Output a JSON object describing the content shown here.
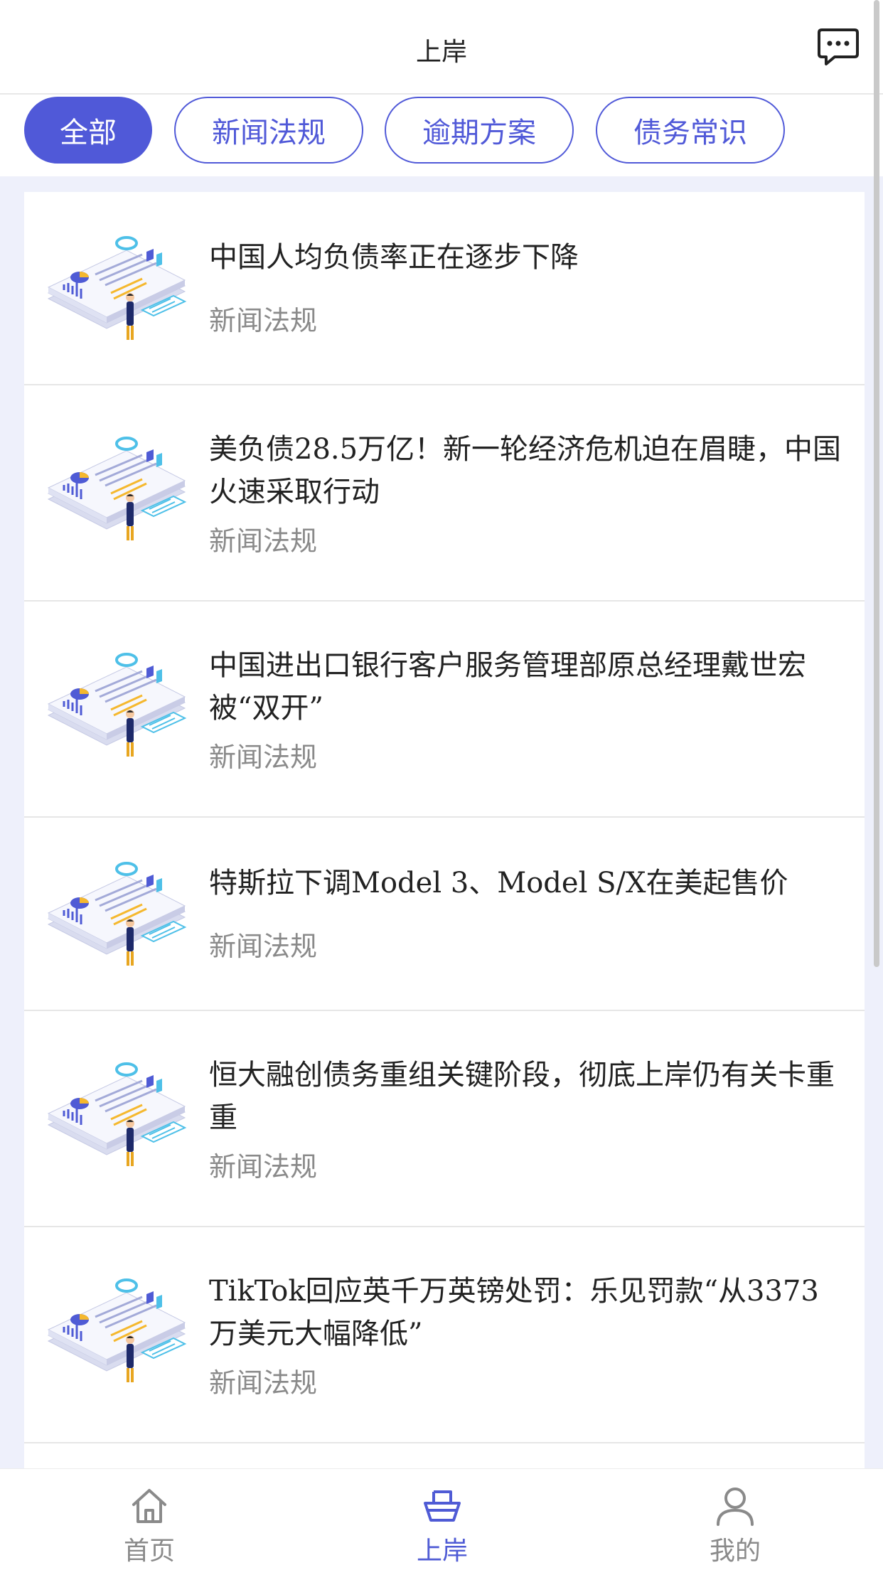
{
  "header": {
    "title": "上岸",
    "message_icon": "chat-bubble-icon"
  },
  "tabs": [
    {
      "label": "全部",
      "active": true
    },
    {
      "label": "新闻法规",
      "active": false
    },
    {
      "label": "逾期方案",
      "active": false
    },
    {
      "label": "债务常识",
      "active": false
    }
  ],
  "articles": [
    {
      "title": "中国人均负债率正在逐步下降",
      "category": "新闻法规"
    },
    {
      "title": "美负债28.5万亿！新一轮经济危机迫在眉睫，中国火速采取行动",
      "category": "新闻法规"
    },
    {
      "title": "中国进出口银行客户服务管理部原总经理戴世宏被“双开”",
      "category": "新闻法规"
    },
    {
      "title": "特斯拉下调Model 3、Model S/X在美起售价",
      "category": "新闻法规"
    },
    {
      "title": "恒大融创债务重组关键阶段，彻底上岸仍有关卡重重",
      "category": "新闻法规"
    },
    {
      "title": "TikTok回应英千万英镑处罚：乐见罚款“从3373万美元大幅降低”",
      "category": "新闻法规"
    }
  ],
  "bottom_nav": [
    {
      "label": "首页",
      "icon": "home-icon",
      "active": false
    },
    {
      "label": "上岸",
      "icon": "boat-icon",
      "active": true
    },
    {
      "label": "我的",
      "icon": "user-icon",
      "active": false
    }
  ],
  "colors": {
    "accent": "#5059d8",
    "background": "#eef0fb",
    "muted_text": "#8a8a8a"
  }
}
